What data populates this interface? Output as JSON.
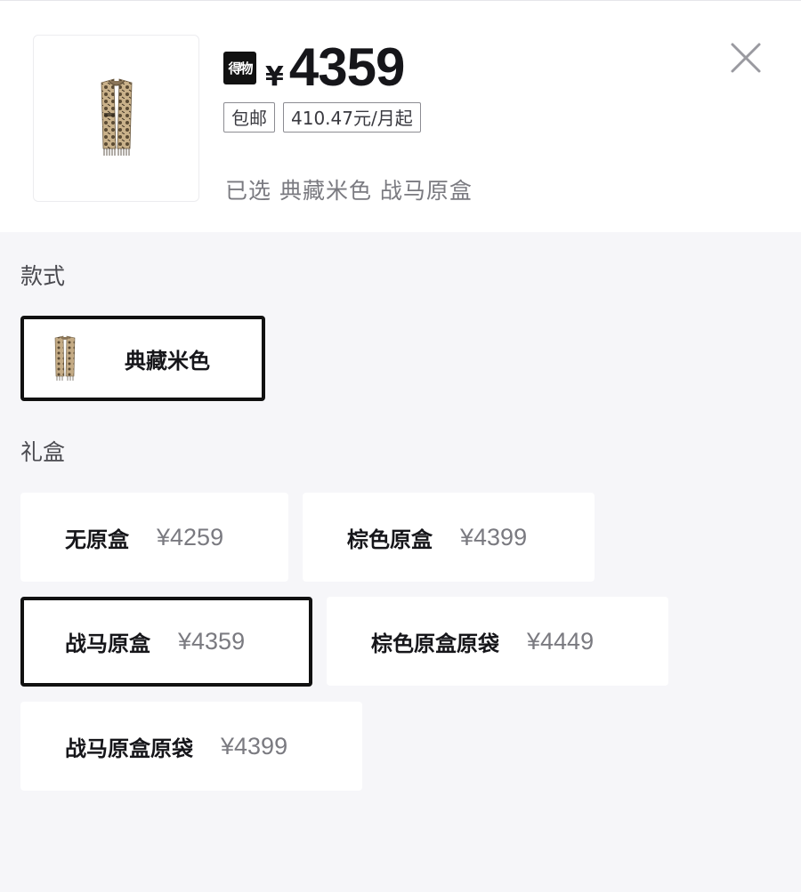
{
  "header": {
    "brand_badge": "得物",
    "currency": "¥",
    "price": "4359",
    "tags": [
      "包邮",
      "410.47元/月起"
    ],
    "selected_text": "已选 典藏米色 战马原盒"
  },
  "style_section": {
    "title": "款式",
    "options": [
      {
        "label": "典藏米色",
        "selected": true
      }
    ]
  },
  "giftbox_section": {
    "title": "礼盒",
    "options": [
      {
        "label": "无原盒",
        "price": "¥4259",
        "selected": false
      },
      {
        "label": "棕色原盒",
        "price": "¥4399",
        "selected": false
      },
      {
        "label": "战马原盒",
        "price": "¥4359",
        "selected": true
      },
      {
        "label": "棕色原盒原袋",
        "price": "¥4449",
        "selected": false
      },
      {
        "label": "战马原盒原袋",
        "price": "¥4399",
        "selected": false
      }
    ]
  },
  "icons": {
    "close": "close-icon",
    "product": "scarf-thumbnail"
  },
  "colors": {
    "selected_border": "#111111",
    "page_bg": "#f6f6f9",
    "price_gray": "#7a7a80"
  }
}
